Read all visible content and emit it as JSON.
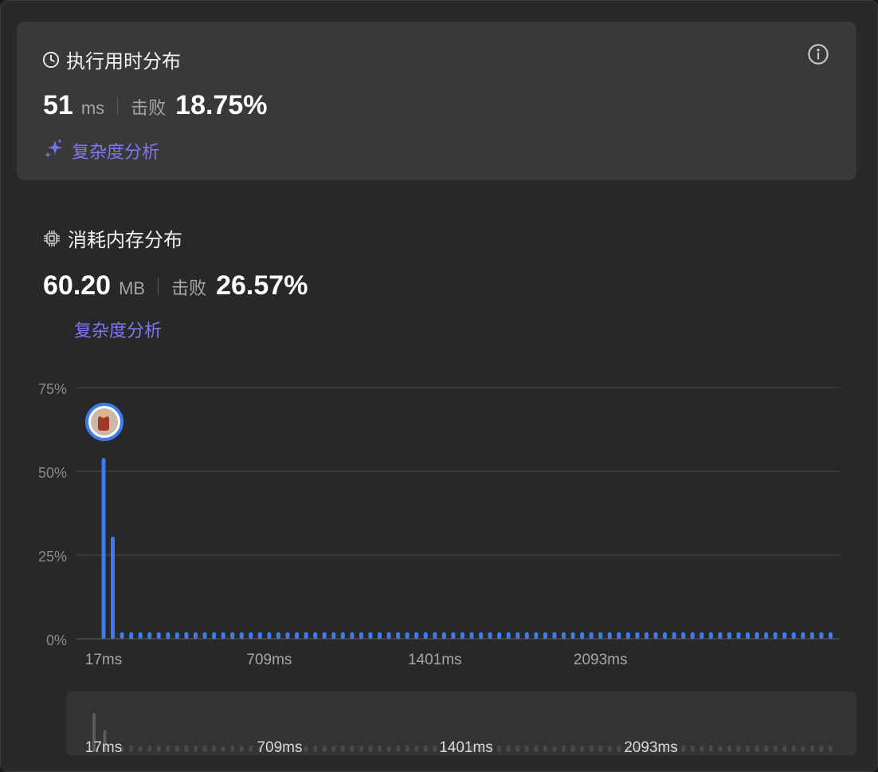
{
  "runtime": {
    "title": "执行用时分布",
    "value": "51",
    "unit": "ms",
    "beat_label": "击败",
    "beat_value": "18.75%",
    "analysis_label": "复杂度分析"
  },
  "memory": {
    "title": "消耗内存分布",
    "value": "60.20",
    "unit": "MB",
    "beat_label": "击败",
    "beat_value": "26.57%",
    "analysis_label": "复杂度分析"
  },
  "icons": {
    "runtime": "clock-icon",
    "memory": "chip-icon",
    "info": "info-icon",
    "analysis": "sparkle-icon",
    "marker": "user-avatar"
  },
  "colors": {
    "bar": "#3b7cf0",
    "bar_navigator": "#5c5c5c",
    "accent": "#7f77f1",
    "grid": "#4a4a4a"
  },
  "chart_data": {
    "type": "bar",
    "ylim": [
      0,
      75
    ],
    "yticks": [
      0,
      25,
      50,
      75
    ],
    "ytick_labels": [
      "0%",
      "25%",
      "50%",
      "75%"
    ],
    "xtick_labels": [
      "17ms",
      "709ms",
      "1401ms",
      "2093ms"
    ],
    "xtick_bar_index": [
      0,
      18,
      36,
      54
    ],
    "values": [
      54,
      30.5,
      2,
      2,
      2,
      2,
      2,
      2,
      2,
      2,
      2,
      2,
      2,
      2,
      2,
      2,
      2,
      2,
      2,
      2,
      2,
      2,
      2,
      2,
      2,
      2,
      2,
      2,
      2,
      2,
      2,
      2,
      2,
      2,
      2,
      2,
      2,
      2,
      2,
      2,
      2,
      2,
      2,
      2,
      2,
      2,
      2,
      2,
      2,
      2,
      2,
      2,
      2,
      2,
      2,
      2,
      2,
      2,
      2,
      2,
      2,
      2,
      2,
      2,
      2,
      2,
      2,
      2,
      2,
      2,
      2,
      2,
      2,
      2,
      2,
      2,
      2,
      2,
      2,
      2
    ],
    "highlight_index": 0,
    "grid": true,
    "legend": "none"
  }
}
